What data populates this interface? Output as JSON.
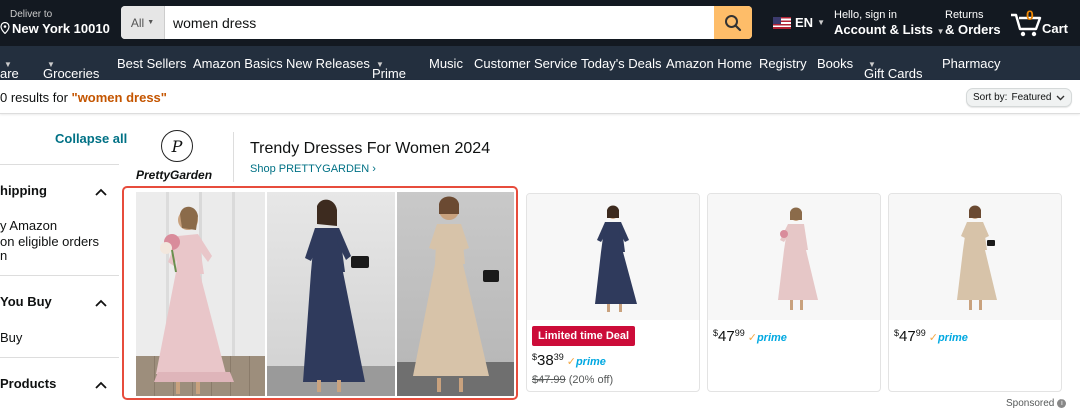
{
  "header": {
    "deliver_line1": "Deliver to",
    "deliver_line2": "New York 10010",
    "search_category": "All",
    "search_value": "women dress",
    "language": "EN",
    "account_line1": "Hello, sign in",
    "account_line2": "Account & Lists",
    "returns_line1": "Returns",
    "returns_line2": "& Orders",
    "cart_count": "0",
    "cart_label": "Cart"
  },
  "subnav": {
    "items": [
      "are",
      "Groceries",
      "Best Sellers",
      "Amazon Basics",
      "New Releases",
      "Prime",
      "Music",
      "Customer Service",
      "Today's Deals",
      "Amazon Home",
      "Registry",
      "Books",
      "Gift Cards",
      "Pharmacy"
    ]
  },
  "results": {
    "prefix": "0 results for ",
    "query": "\"women dress\"",
    "sort_label": "Sort by:",
    "sort_value": "Featured"
  },
  "filters": {
    "collapse_all": "Collapse all",
    "shipping_title": "hipping",
    "shipping_line1": "y Amazon",
    "shipping_line2": "on eligible orders",
    "shipping_line3": "n",
    "youbuy_title": "You Buy",
    "youbuy_line1": "Buy",
    "products_title": "Products"
  },
  "brand": {
    "logo_mark": "P",
    "logo_name": "PrettyGarden",
    "headline": "Trendy Dresses For Women 2024",
    "shop_link": "Shop PRETTYGARDEN ›"
  },
  "products": [
    {
      "deal_badge": "Limited time Deal",
      "price_dollars": "38",
      "price_cents": "39",
      "prime": "prime",
      "was_price": "$47.99",
      "discount": "(20% off)"
    },
    {
      "price_dollars": "47",
      "price_cents": "99",
      "prime": "prime"
    },
    {
      "price_dollars": "47",
      "price_cents": "99",
      "prime": "prime"
    }
  ],
  "sponsored": "Sponsored",
  "colors": {
    "header_bg": "#131921",
    "subnav_bg": "#232f3e",
    "search_button": "#febd69",
    "query_orange": "#c45500",
    "link_teal": "#007185",
    "deal_red": "#cc0c39",
    "highlight_border": "#e74c3c"
  }
}
